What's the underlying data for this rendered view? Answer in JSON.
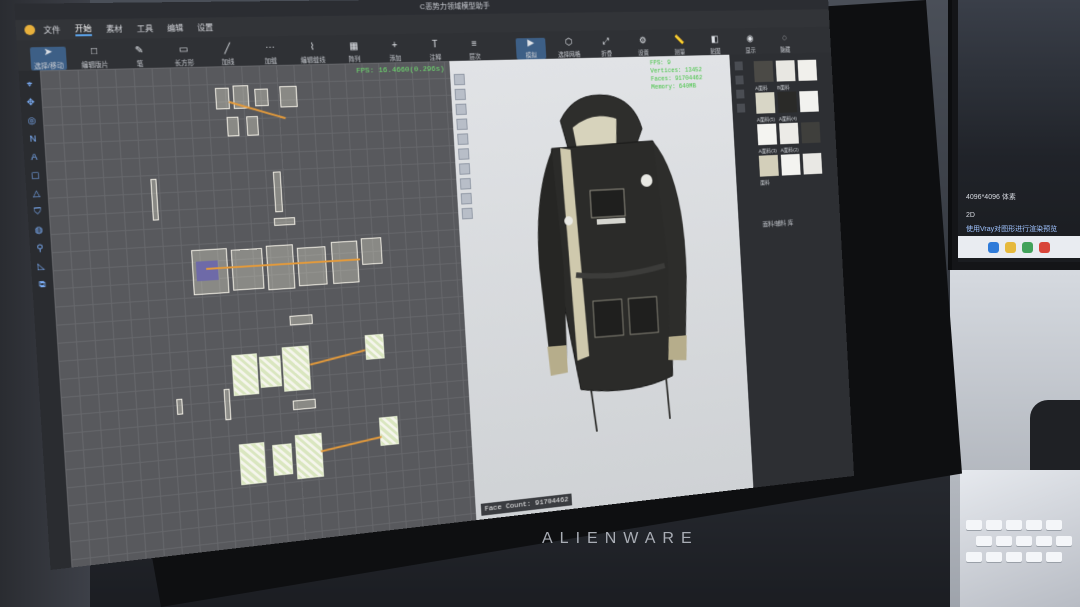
{
  "window": {
    "title": "C恶势力领域模型助手"
  },
  "menu": {
    "items": [
      "文件",
      "开始",
      "素材",
      "工具",
      "编辑",
      "设置"
    ],
    "active_index": 1
  },
  "toolbar": {
    "left_tools": [
      "选择/移动",
      "编辑版片",
      "笔",
      "长方形",
      "加线",
      "加缝",
      "编辑缝线",
      "阵列",
      "添加",
      "注释",
      "层次"
    ],
    "right_tools": [
      "模拟",
      "选择网格",
      "折叠",
      "设置",
      "测量",
      "贴图",
      "显示",
      "隐藏"
    ]
  },
  "pattern_view": {
    "fps": "FPS: 16.4660(0.296s)"
  },
  "view3d": {
    "stats": [
      "FPS: 9",
      "Vertices: 13452",
      "Faces: 91704462",
      "Memory: 640MB"
    ],
    "face_count": "Face Count: 91704462"
  },
  "library": {
    "swatch_labels": [
      "A面料",
      "B面料",
      "A面料(5)",
      "A面料(4)",
      "A面料(3)",
      "A面料(2)",
      "面料"
    ],
    "footer": "面料/辅料 库"
  },
  "bezel": {
    "brand": "ALIENWARE"
  },
  "monitor2": {
    "line1": "4096*4096 体素",
    "line2": "使用Vray对图形进行渲染预览",
    "badge": "2D"
  },
  "colors": {
    "jacket_body": "#2b2b29",
    "jacket_lining": "#d7d3bc",
    "accent_orange": "#e39a3b",
    "fps_green": "#6fe06f"
  }
}
